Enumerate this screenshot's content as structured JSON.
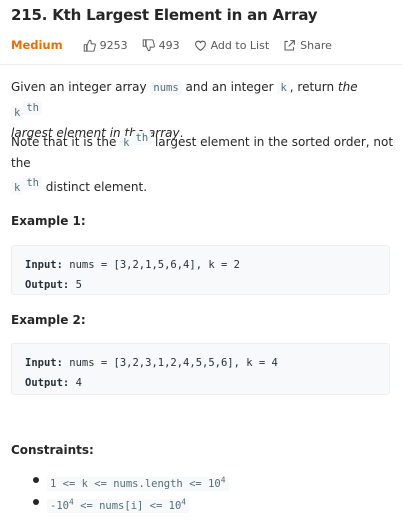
{
  "problem": {
    "title": "215. Kth Largest Element in an Array",
    "difficulty": "Medium",
    "likes": "9253",
    "dislikes": "493",
    "add_to_list": "Add to List",
    "share": "Share"
  },
  "description": {
    "p1_a": "Given an integer array ",
    "p1_code_nums": "nums",
    "p1_b": " and an integer ",
    "p1_code_k": "k",
    "p1_c": ", return ",
    "p1_em1": "the ",
    "p1_k": "k",
    "p1_sup": "th",
    "p1_em2": "largest element in the array",
    "p1_end": ".",
    "p2_a": "Note that it is the ",
    "p2_k": "k",
    "p2_sup": "th",
    "p2_b": " largest element in the sorted order, not the",
    "p2_k2": "k",
    "p2_sup2": "th",
    "p2_c": " distinct element."
  },
  "examples": [
    {
      "heading": "Example 1:",
      "input_label": "Input:",
      "input_value": " nums = [3,2,1,5,6,4], k = 2",
      "output_label": "Output:",
      "output_value": " 5"
    },
    {
      "heading": "Example 2:",
      "input_label": "Input:",
      "input_value": " nums = [3,2,3,1,2,4,5,5,6], k = 4",
      "output_label": "Output:",
      "output_value": " 4"
    }
  ],
  "constraints": {
    "heading": "Constraints:",
    "c1_a": "1 <= k <= nums.length <= 10",
    "c1_sup": "4",
    "c2_a": "-10",
    "c2_sup": "4",
    "c2_b": " <= nums[i] <= 10",
    "c2_sup2": "4"
  },
  "icons": {
    "like": "thumbs-up-icon",
    "dislike": "thumbs-down-icon",
    "add": "heart-icon",
    "share": "share-icon"
  },
  "colors": {
    "difficulty_medium": "#ef6c00",
    "text": "#262626",
    "code_bg": "#f7f9fa"
  }
}
